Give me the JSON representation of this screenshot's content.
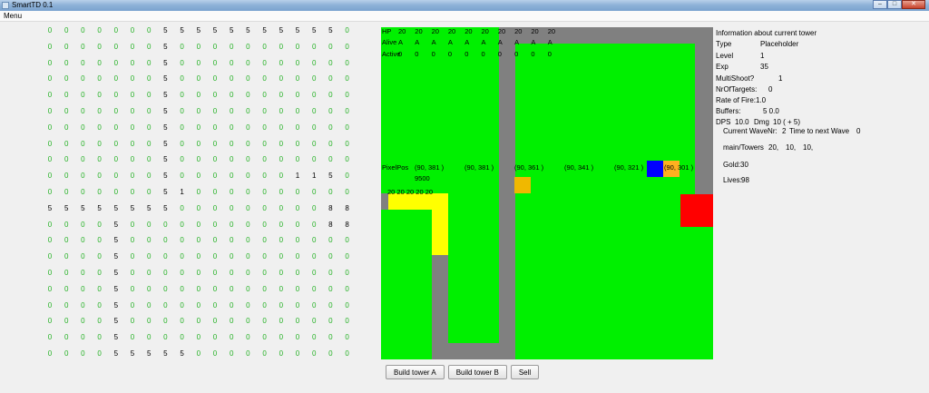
{
  "window": {
    "title": "SmartTD 0.1",
    "minimize": "–",
    "maximize": "□",
    "close": "✕"
  },
  "menu": {
    "label": "Menu"
  },
  "grid": {
    "rows": [
      "0000000555555555550",
      "0000000500000000000",
      "0000000500000000000",
      "0000000500000000000",
      "0000000500000000000",
      "0000000500000000000",
      "0000000500000000000",
      "0000000500000000000",
      "0000000500000000000",
      "0000000500000001150",
      "0000000510000000000",
      "5555555500000000088",
      "0000500000000000088",
      "0000500000000000000",
      "0000500000000000000",
      "0000500000000000000",
      "0000500000000000000",
      "0000500000000000000",
      "0000500000000000000",
      "0000500000000000000",
      "0000555550000000000"
    ]
  },
  "map_overlay": {
    "hp_label": "HP",
    "hp_values": [
      "20",
      "20",
      "20",
      "20",
      "20",
      "20",
      "20",
      "20",
      "20",
      "20"
    ],
    "alive_label": "Alive",
    "alive_values": [
      "A",
      "A",
      "A",
      "A",
      "A",
      "A",
      "A",
      "A",
      "A",
      "A"
    ],
    "active_label": "Active",
    "active_values": [
      "0",
      "0",
      "0",
      "0",
      "0",
      "0",
      "0",
      "0",
      "0",
      "0"
    ],
    "pixelpos_label": "PixelPos",
    "positions": [
      "(90, 381 )",
      "(90, 381 )",
      "(90, 361 )",
      "(90, 341 )",
      "(90, 321 )",
      "(90, 301 )"
    ],
    "value_9500": "9500",
    "tower_hp": "20 20 20 20 20"
  },
  "info": {
    "header": "Information about current tower",
    "type_label": "Type",
    "type_value": "Placeholder",
    "level_label": "Level",
    "level_value": "1",
    "exp_label": "Exp",
    "exp_value": "35",
    "multishoot_label": "MultiShoot?",
    "multishoot_value": "1",
    "nroftargets_label": "NrOfTargets:",
    "nroftargets_value": "0",
    "rateoffire_label": "Rate of Fire:",
    "rateoffire_value": "1.0",
    "buffers_label": "Buffers:",
    "buffers_value": "5 0.0",
    "dps_label": "DPS",
    "dps_value": "10.0",
    "dmg_label": "Dmg",
    "dmg_value": "10 ( + 5)",
    "wave_label": "Current WaveNr:",
    "wave_value": "2",
    "nextwave_label": "Time to next Wave",
    "nextwave_value": "0",
    "towers_label": "main/Towers",
    "towers_values": [
      "20,",
      "10,",
      "10,"
    ],
    "gold_label": "Gold:",
    "gold_value": "30",
    "lives_label": "Lives:",
    "lives_value": "98"
  },
  "buttons": {
    "build_a": "Build tower A",
    "build_b": "Build tower B",
    "sell": "Sell"
  },
  "colors": {
    "grass": "#00f000",
    "path": "#808080",
    "tower_yellow": "#ffff00",
    "enemy_blue": "#0000ff",
    "enemy_orange": "#ffb020",
    "base_red": "#ff0000"
  }
}
